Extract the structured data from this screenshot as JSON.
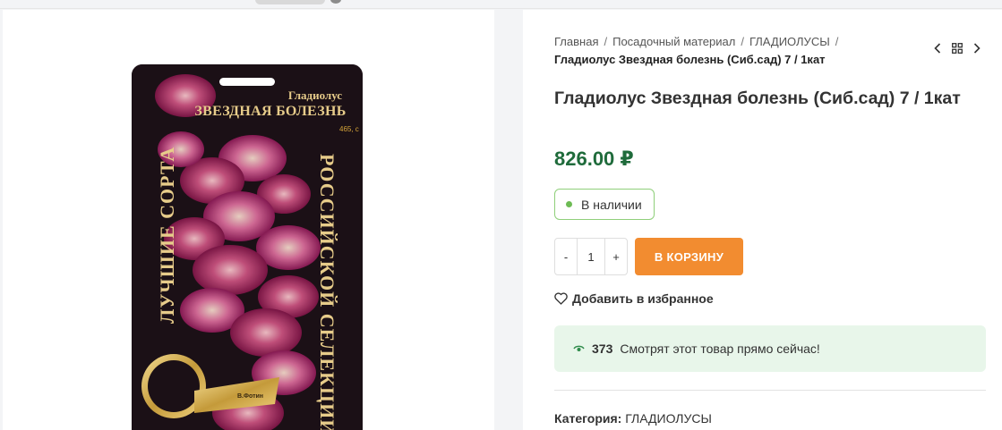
{
  "breadcrumb": {
    "home": "Главная",
    "section": "Посадочный материал",
    "category": "ГЛАДИОЛУСЫ",
    "current": "Гладиолус Звездная болезнь (Сиб.сад) 7 / 1кат",
    "separator": "/"
  },
  "nav": {
    "prev_icon": "chevron-left-icon",
    "grid_icon": "grid-icon",
    "next_icon": "chevron-right-icon"
  },
  "product": {
    "title": "Гладиолус Звездная болезнь (Сиб.сад) 7 / 1кат",
    "price": "826.00 ₽",
    "stock_label": "В наличии",
    "quantity": "1",
    "qty_minus": "-",
    "qty_plus": "+",
    "add_to_cart": "В КОРЗИНУ",
    "wishlist_label": "Добавить в избранное",
    "viewers_count": "373",
    "viewers_text": "Смотрят этот товар прямо сейчас!",
    "category_label": "Категория:",
    "category_value": "ГЛАДИОЛУСЫ"
  },
  "packet": {
    "title_small": "Гладиолус",
    "title_big": "ЗВЕЗДНАЯ БОЛЕЗНЬ",
    "code": "465, с",
    "vertical_left": "ЛУЧШИЕ СОРТА",
    "vertical_right": "РОССИЙСКОЙ СЕЛЕКЦИИ",
    "ribbon": "В.Фотин"
  },
  "colors": {
    "price": "#1f6b3b",
    "cart_button": "#f28c30",
    "stock_border": "#8fcf7a",
    "stock_dot": "#6dbb54",
    "viewers_bg": "#e8f6ea"
  }
}
